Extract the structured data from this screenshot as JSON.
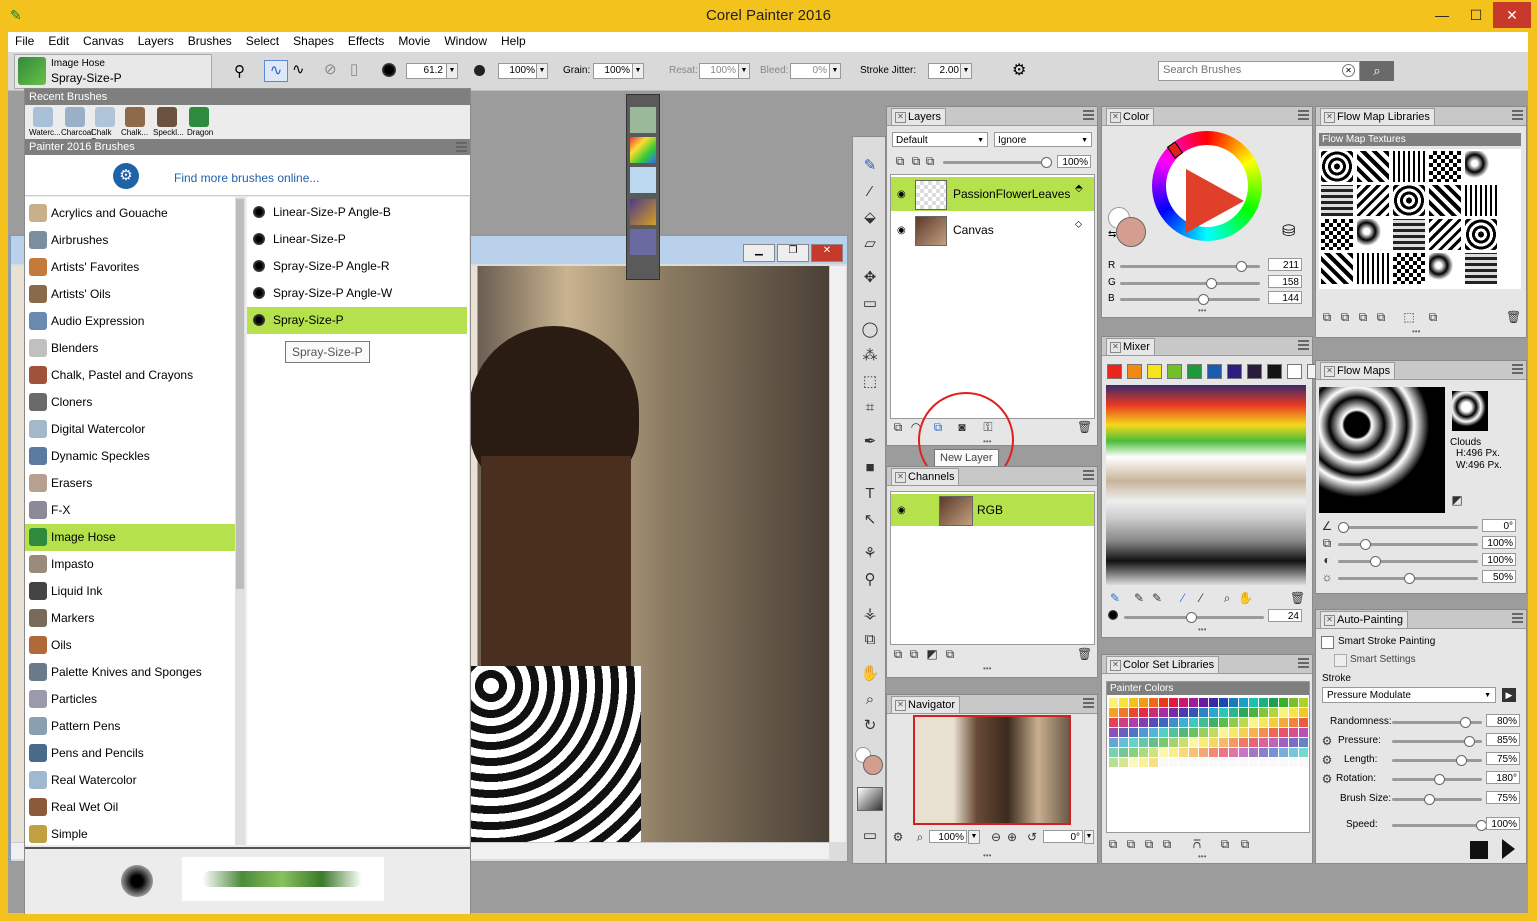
{
  "window": {
    "title": "Corel Painter 2016",
    "minimize": "—",
    "maximize": "☐",
    "close": "✕"
  },
  "menu": [
    "File",
    "Edit",
    "Canvas",
    "Layers",
    "Brushes",
    "Select",
    "Shapes",
    "Effects",
    "Movie",
    "Window",
    "Help"
  ],
  "toolbar": {
    "brush_category": "Image Hose",
    "brush_variant": "Spray-Size-P",
    "size": "61.2",
    "opacity": "100%",
    "grain_label": "Grain:",
    "grain": "100%",
    "resat_label": "Resat:",
    "resat": "100%",
    "bleed_label": "Bleed:",
    "bleed": "0%",
    "stroke_jitter_label": "Stroke Jitter:",
    "stroke_jitter": "2.00",
    "search_placeholder": "Search Brushes"
  },
  "brush_selector": {
    "recent_header": "Recent Brushes",
    "recent": [
      "Waterc...",
      "Charcoal",
      "Chalk S...",
      "Chalk...",
      "Speckl...",
      "Dragon"
    ],
    "library_header": "Painter 2016 Brushes",
    "find_more": "Find more brushes online...",
    "categories": [
      "Acrylics and Gouache",
      "Airbrushes",
      "Artists' Favorites",
      "Artists' Oils",
      "Audio Expression",
      "Blenders",
      "Chalk, Pastel and Crayons",
      "Cloners",
      "Digital Watercolor",
      "Dynamic Speckles",
      "Erasers",
      "F-X",
      "Image Hose",
      "Impasto",
      "Liquid Ink",
      "Markers",
      "Oils",
      "Palette Knives and Sponges",
      "Particles",
      "Pattern Pens",
      "Pens and Pencils",
      "Real Watercolor",
      "Real Wet Oil",
      "Simple"
    ],
    "selected_category": "Image Hose",
    "variants": [
      "Linear-Size-P Angle-B",
      "Linear-Size-P",
      "Spray-Size-P Angle-R",
      "Spray-Size-P Angle-W",
      "Spray-Size-P"
    ],
    "selected_variant": "Spray-Size-P",
    "tooltip": "Spray-Size-P"
  },
  "layers": {
    "tab": "Layers",
    "composite_method": "Default",
    "preserve": "Ignore",
    "opacity": "100%",
    "items": [
      "PassionFlowerLeaves",
      "Canvas"
    ],
    "selected": "PassionFlowerLeaves",
    "tooltip": "New Layer"
  },
  "channels": {
    "tab": "Channels",
    "items": [
      "RGB"
    ]
  },
  "navigator": {
    "tab": "Navigator",
    "zoom": "100%",
    "rotation": "0°"
  },
  "color": {
    "tab": "Color",
    "r_label": "R",
    "g_label": "G",
    "b_label": "B",
    "r": "211",
    "g": "158",
    "b": "144",
    "main_color": "#d39e90"
  },
  "mixer": {
    "tab": "Mixer",
    "size": "24",
    "swatches": [
      "#e8261c",
      "#f08a12",
      "#f5e41a",
      "#70c02a",
      "#1e9a3a",
      "#1a5bb0",
      "#2d1e82",
      "#2b1b3a",
      "#141414",
      "#ffffff",
      "#f4f4f4"
    ]
  },
  "color_set": {
    "tab": "Color Set Libraries",
    "name": "Painter Colors"
  },
  "flow_map_libraries": {
    "tab": "Flow Map Libraries",
    "section": "Flow Map Textures"
  },
  "flow_maps": {
    "tab": "Flow Maps",
    "name": "Clouds",
    "height": "H:496 Px.",
    "width": "W:496 Px.",
    "values": [
      "0°",
      "100%",
      "100%",
      "50%"
    ]
  },
  "auto_painting": {
    "tab": "Auto-Painting",
    "smart_stroke": "Smart Stroke Painting",
    "smart_settings": "Smart Settings",
    "stroke_label": "Stroke",
    "stroke": "Pressure Modulate",
    "params": [
      {
        "label": "Randomness:",
        "value": "80%"
      },
      {
        "label": "Pressure:",
        "value": "85%"
      },
      {
        "label": "Length:",
        "value": "75%"
      },
      {
        "label": "Rotation:",
        "value": "180°"
      },
      {
        "label": "Brush Size:",
        "value": "75%"
      }
    ],
    "speed_label": "Speed:",
    "speed": "100%"
  }
}
